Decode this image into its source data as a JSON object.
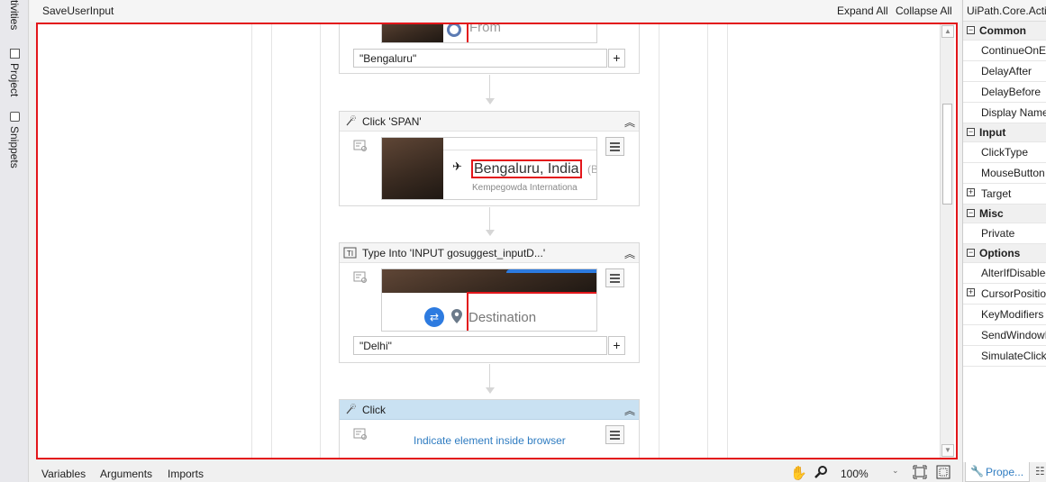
{
  "left_tabs": [
    "Activities",
    "Project",
    "Snippets"
  ],
  "designer": {
    "title": "SaveUserInput",
    "expand_all": "Expand All",
    "collapse_all": "Collapse All"
  },
  "activities": [
    {
      "type": "type_into",
      "thumbnail_text": "From",
      "input_value": "\"Bengaluru\""
    },
    {
      "type": "click",
      "title": "Click 'SPAN'",
      "thumbnail_text": "Bengaluru, India",
      "thumbnail_suffix": "(B",
      "thumbnail_sub": "Kempegowda Internationa"
    },
    {
      "type": "type_into",
      "title": "Type Into 'INPUT  gosuggest_inputD...'",
      "thumbnail_text": "Destination",
      "input_value": "\"Delhi\""
    },
    {
      "type": "click",
      "title": "Click",
      "link_text": "Indicate element inside browser"
    }
  ],
  "bottom_bar": {
    "tabs": [
      "Variables",
      "Arguments",
      "Imports"
    ],
    "zoom": "100%"
  },
  "properties": {
    "title": "UiPath.Core.Activities.Click",
    "rows": [
      {
        "kind": "category",
        "label": "Common"
      },
      {
        "kind": "prop",
        "label": "ContinueOnError"
      },
      {
        "kind": "prop",
        "label": "DelayAfter"
      },
      {
        "kind": "prop",
        "label": "DelayBefore"
      },
      {
        "kind": "prop",
        "label": "Display Name"
      },
      {
        "kind": "category",
        "label": "Input"
      },
      {
        "kind": "prop",
        "label": "ClickType"
      },
      {
        "kind": "prop",
        "label": "MouseButton"
      },
      {
        "kind": "expandable",
        "label": "Target"
      },
      {
        "kind": "category",
        "label": "Misc"
      },
      {
        "kind": "prop",
        "label": "Private"
      },
      {
        "kind": "category",
        "label": "Options"
      },
      {
        "kind": "prop",
        "label": "AlterIfDisabled"
      },
      {
        "kind": "expandable",
        "label": "CursorPosition"
      },
      {
        "kind": "prop",
        "label": "KeyModifiers"
      },
      {
        "kind": "prop",
        "label": "SendWindowMessages"
      },
      {
        "kind": "prop",
        "label": "SimulateClick"
      }
    ],
    "tab_label": "Prope..."
  },
  "colors": {
    "selection_border": "#e3161b",
    "selected_header": "#c9e1f2",
    "link": "#2f7cc1"
  }
}
